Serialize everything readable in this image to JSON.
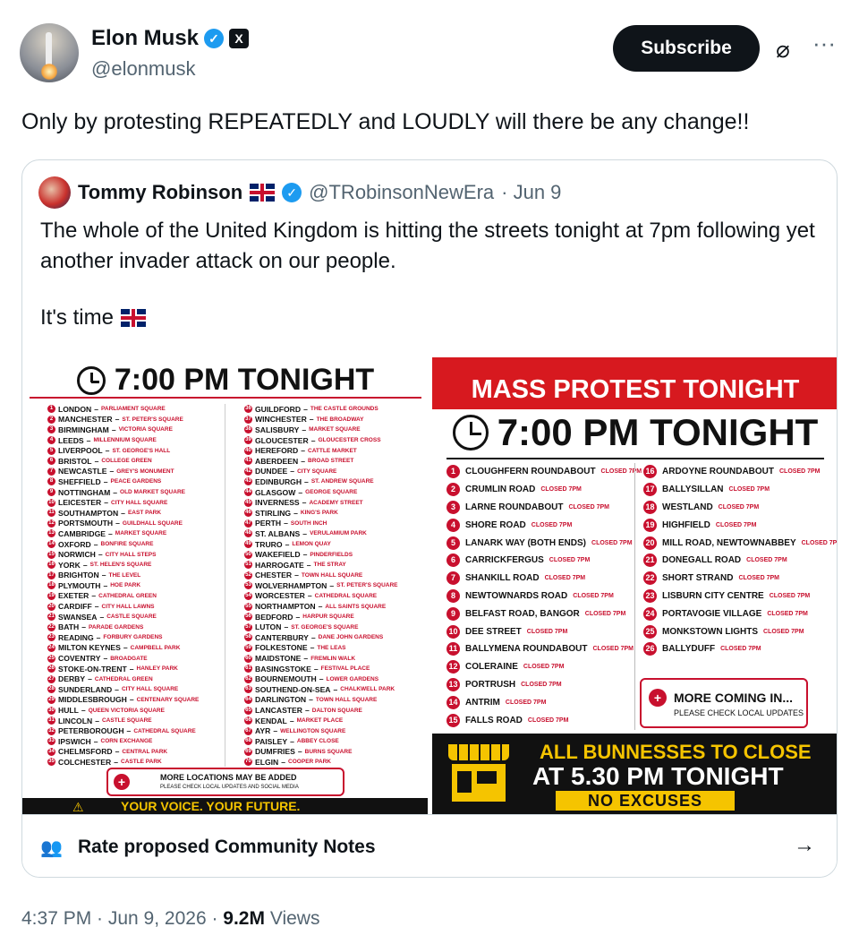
{
  "author": {
    "name": "Elon Musk",
    "handle": "@elonmusk",
    "subscribe_label": "Subscribe"
  },
  "post_text": "Only by protesting REPEATEDLY and LOUDLY will there be any change!!",
  "quote": {
    "name": "Tommy Robinson",
    "handle": "@TRobinsonNewEra",
    "date": "· Jun 9",
    "text": "The whole of the United Kingdom is hitting the streets tonight at 7pm following yet another invader attack on our people.",
    "text2": "It's time"
  },
  "image1": {
    "title": "7:00 PM TONIGHT",
    "left_col": [
      {
        "n": "1",
        "name": "LONDON",
        "sub": "PARLIAMENT SQUARE"
      },
      {
        "n": "2",
        "name": "MANCHESTER",
        "sub": "ST. PETER'S SQUARE"
      },
      {
        "n": "3",
        "name": "BIRMINGHAM",
        "sub": "VICTORIA SQUARE"
      },
      {
        "n": "4",
        "name": "LEEDS",
        "sub": "MILLENNIUM SQUARE"
      },
      {
        "n": "5",
        "name": "LIVERPOOL",
        "sub": "ST. GEORGE'S HALL"
      },
      {
        "n": "6",
        "name": "BRISTOL",
        "sub": "COLLEGE GREEN"
      },
      {
        "n": "7",
        "name": "NEWCASTLE",
        "sub": "GREY'S MONUMENT"
      },
      {
        "n": "8",
        "name": "SHEFFIELD",
        "sub": "PEACE GARDENS"
      },
      {
        "n": "9",
        "name": "NOTTINGHAM",
        "sub": "OLD MARKET SQUARE"
      },
      {
        "n": "10",
        "name": "LEICESTER",
        "sub": "CITY HALL SQUARE"
      },
      {
        "n": "11",
        "name": "SOUTHAMPTON",
        "sub": "EAST PARK"
      },
      {
        "n": "12",
        "name": "PORTSMOUTH",
        "sub": "GUILDHALL SQUARE"
      },
      {
        "n": "13",
        "name": "CAMBRIDGE",
        "sub": "MARKET SQUARE"
      },
      {
        "n": "14",
        "name": "OXFORD",
        "sub": "BONFIRE SQUARE"
      },
      {
        "n": "15",
        "name": "NORWICH",
        "sub": "CITY HALL STEPS"
      },
      {
        "n": "16",
        "name": "YORK",
        "sub": "ST. HELEN'S SQUARE"
      },
      {
        "n": "17",
        "name": "BRIGHTON",
        "sub": "THE LEVEL"
      },
      {
        "n": "18",
        "name": "PLYMOUTH",
        "sub": "HOE PARK"
      },
      {
        "n": "19",
        "name": "EXETER",
        "sub": "CATHEDRAL GREEN"
      },
      {
        "n": "20",
        "name": "CARDIFF",
        "sub": "CITY HALL LAWNS"
      },
      {
        "n": "21",
        "name": "SWANSEA",
        "sub": "CASTLE SQUARE"
      },
      {
        "n": "22",
        "name": "BATH",
        "sub": "PARADE GARDENS"
      },
      {
        "n": "23",
        "name": "READING",
        "sub": "FORBURY GARDENS"
      },
      {
        "n": "24",
        "name": "MILTON KEYNES",
        "sub": "CAMPBELL PARK"
      },
      {
        "n": "25",
        "name": "COVENTRY",
        "sub": "BROADGATE"
      },
      {
        "n": "26",
        "name": "STOKE-ON-TRENT",
        "sub": "HANLEY PARK"
      },
      {
        "n": "27",
        "name": "DERBY",
        "sub": "CATHEDRAL GREEN"
      },
      {
        "n": "28",
        "name": "SUNDERLAND",
        "sub": "CITY HALL SQUARE"
      },
      {
        "n": "29",
        "name": "MIDDLESBROUGH",
        "sub": "CENTENARY SQUARE"
      },
      {
        "n": "30",
        "name": "HULL",
        "sub": "QUEEN VICTORIA SQUARE"
      },
      {
        "n": "31",
        "name": "LINCOLN",
        "sub": "CASTLE SQUARE"
      },
      {
        "n": "32",
        "name": "PETERBOROUGH",
        "sub": "CATHEDRAL SQUARE"
      },
      {
        "n": "33",
        "name": "IPSWICH",
        "sub": "CORN EXCHANGE"
      },
      {
        "n": "34",
        "name": "CHELMSFORD",
        "sub": "CENTRAL PARK"
      },
      {
        "n": "35",
        "name": "COLCHESTER",
        "sub": "CASTLE PARK"
      }
    ],
    "right_col": [
      {
        "n": "36",
        "name": "GUILDFORD",
        "sub": "THE CASTLE GROUNDS"
      },
      {
        "n": "37",
        "name": "WINCHESTER",
        "sub": "THE BROADWAY"
      },
      {
        "n": "38",
        "name": "SALISBURY",
        "sub": "MARKET SQUARE"
      },
      {
        "n": "39",
        "name": "GLOUCESTER",
        "sub": "GLOUCESTER CROSS"
      },
      {
        "n": "40",
        "name": "HEREFORD",
        "sub": "CATTLE MARKET"
      },
      {
        "n": "41",
        "name": "ABERDEEN",
        "sub": "BROAD STREET"
      },
      {
        "n": "42",
        "name": "DUNDEE",
        "sub": "CITY SQUARE"
      },
      {
        "n": "43",
        "name": "EDINBURGH",
        "sub": "ST. ANDREW SQUARE"
      },
      {
        "n": "44",
        "name": "GLASGOW",
        "sub": "GEORGE SQUARE"
      },
      {
        "n": "45",
        "name": "INVERNESS",
        "sub": "ACADEMY STREET"
      },
      {
        "n": "46",
        "name": "STIRLING",
        "sub": "KING'S PARK"
      },
      {
        "n": "47",
        "name": "PERTH",
        "sub": "SOUTH INCH"
      },
      {
        "n": "48",
        "name": "ST. ALBANS",
        "sub": "VERULAMIUM PARK"
      },
      {
        "n": "49",
        "name": "TRURO",
        "sub": "LEMON QUAY"
      },
      {
        "n": "50",
        "name": "WAKEFIELD",
        "sub": "PINDERFIELDS"
      },
      {
        "n": "51",
        "name": "HARROGATE",
        "sub": "THE STRAY"
      },
      {
        "n": "52",
        "name": "CHESTER",
        "sub": "TOWN HALL SQUARE"
      },
      {
        "n": "53",
        "name": "WOLVERHAMPTON",
        "sub": "ST. PETER'S SQUARE"
      },
      {
        "n": "54",
        "name": "WORCESTER",
        "sub": "CATHEDRAL SQUARE"
      },
      {
        "n": "55",
        "name": "NORTHAMPTON",
        "sub": "ALL SAINTS SQUARE"
      },
      {
        "n": "56",
        "name": "BEDFORD",
        "sub": "HARPUR SQUARE"
      },
      {
        "n": "57",
        "name": "LUTON",
        "sub": "ST. GEORGE'S SQUARE"
      },
      {
        "n": "58",
        "name": "CANTERBURY",
        "sub": "DANE JOHN GARDENS"
      },
      {
        "n": "59",
        "name": "FOLKESTONE",
        "sub": "THE LEAS"
      },
      {
        "n": "60",
        "name": "MAIDSTONE",
        "sub": "FREMLIN WALK"
      },
      {
        "n": "61",
        "name": "BASINGSTOKE",
        "sub": "FESTIVAL PLACE"
      },
      {
        "n": "62",
        "name": "BOURNEMOUTH",
        "sub": "LOWER GARDENS"
      },
      {
        "n": "63",
        "name": "SOUTHEND-ON-SEA",
        "sub": "CHALKWELL PARK"
      },
      {
        "n": "64",
        "name": "DARLINGTON",
        "sub": "TOWN HALL SQUARE"
      },
      {
        "n": "65",
        "name": "LANCASTER",
        "sub": "DALTON SQUARE"
      },
      {
        "n": "66",
        "name": "KENDAL",
        "sub": "MARKET PLACE"
      },
      {
        "n": "67",
        "name": "AYR",
        "sub": "WELLINGTON SQUARE"
      },
      {
        "n": "68",
        "name": "PAISLEY",
        "sub": "ABBEY CLOSE"
      },
      {
        "n": "69",
        "name": "DUMFRIES",
        "sub": "BURNS SQUARE"
      },
      {
        "n": "70",
        "name": "ELGIN",
        "sub": "COOPER PARK"
      }
    ],
    "more_title": "MORE LOCATIONS MAY BE ADDED",
    "more_sub": "PLEASE CHECK LOCAL UPDATES AND SOCIAL MEDIA",
    "band_text": "YOUR VOICE. YOUR FUTURE."
  },
  "image2": {
    "header": "MASS PROTEST TONIGHT",
    "title": "7:00 PM TONIGHT",
    "left_col": [
      {
        "n": "1",
        "name": "CLOUGHFERN ROUNDABOUT",
        "status": "CLOSED 7PM"
      },
      {
        "n": "2",
        "name": "CRUMLIN ROAD",
        "status": "CLOSED 7PM"
      },
      {
        "n": "3",
        "name": "LARNE ROUNDABOUT",
        "status": "CLOSED 7PM"
      },
      {
        "n": "4",
        "name": "SHORE ROAD",
        "status": "CLOSED 7PM"
      },
      {
        "n": "5",
        "name": "LANARK WAY (BOTH ENDS)",
        "status": "CLOSED 7PM"
      },
      {
        "n": "6",
        "name": "CARRICKFERGUS",
        "status": "CLOSED 7PM"
      },
      {
        "n": "7",
        "name": "SHANKILL ROAD",
        "status": "CLOSED 7PM"
      },
      {
        "n": "8",
        "name": "NEWTOWNARDS ROAD",
        "status": "CLOSED 7PM"
      },
      {
        "n": "9",
        "name": "BELFAST ROAD, BANGOR",
        "status": "CLOSED 7PM"
      },
      {
        "n": "10",
        "name": "DEE STREET",
        "status": "CLOSED 7PM"
      },
      {
        "n": "11",
        "name": "BALLYMENA ROUNDABOUT",
        "status": "CLOSED 7PM"
      },
      {
        "n": "12",
        "name": "COLERAINE",
        "status": "CLOSED 7PM"
      },
      {
        "n": "13",
        "name": "PORTRUSH",
        "status": "CLOSED 7PM"
      },
      {
        "n": "14",
        "name": "ANTRIM",
        "status": "CLOSED 7PM"
      },
      {
        "n": "15",
        "name": "FALLS ROAD",
        "status": "CLOSED 7PM"
      }
    ],
    "right_col": [
      {
        "n": "16",
        "name": "ARDOYNE ROUNDABOUT",
        "status": "CLOSED 7PM"
      },
      {
        "n": "17",
        "name": "BALLYSILLAN",
        "status": "CLOSED 7PM"
      },
      {
        "n": "18",
        "name": "WESTLAND",
        "status": "CLOSED 7PM"
      },
      {
        "n": "19",
        "name": "HIGHFIELD",
        "status": "CLOSED 7PM"
      },
      {
        "n": "20",
        "name": "MILL ROAD, NEWTOWNABBEY",
        "status": "CLOSED 7PM"
      },
      {
        "n": "21",
        "name": "DONEGALL ROAD",
        "status": "CLOSED 7PM"
      },
      {
        "n": "22",
        "name": "SHORT STRAND",
        "status": "CLOSED 7PM"
      },
      {
        "n": "23",
        "name": "LISBURN CITY CENTRE",
        "status": "CLOSED 7PM"
      },
      {
        "n": "24",
        "name": "PORTAVOGIE VILLAGE",
        "status": "CLOSED 7PM"
      },
      {
        "n": "25",
        "name": "MONKSTOWN LIGHTS",
        "status": "CLOSED 7PM"
      },
      {
        "n": "26",
        "name": "BALLYDUFF",
        "status": "CLOSED 7PM"
      }
    ],
    "more_title": "MORE COMING IN...",
    "more_sub": "PLEASE CHECK LOCAL UPDATES",
    "banner_line1": "ALL BUNNESSES TO CLOSE",
    "banner_line2": "AT 5.30 PM TONIGHT",
    "banner_line3": "NO EXCUSES"
  },
  "community_notes": {
    "label": "Rate proposed Community Notes",
    "arrow": "→"
  },
  "footer": {
    "time": "4:37 PM · Jun 9, 2026 · ",
    "views_count": "9.2M",
    "views_label": " Views"
  },
  "colors": {
    "accent": "#1d9bf0",
    "red": "#c8102e",
    "yellow": "#f5c400"
  }
}
